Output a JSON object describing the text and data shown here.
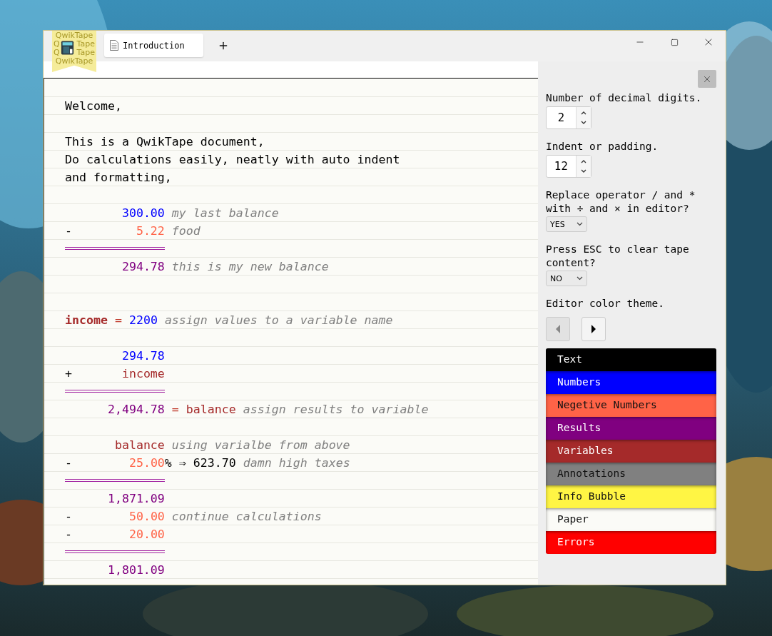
{
  "logo": {
    "pattern": [
      [
        "QwikTape"
      ],
      [
        "Q",
        "Tape"
      ],
      [
        "Q",
        "Tape"
      ],
      [
        "QwikTape"
      ]
    ]
  },
  "tabs": [
    {
      "label": "Introduction",
      "selected": true
    }
  ],
  "tape": [
    {
      "kind": "blank"
    },
    {
      "kind": "text",
      "segments": [
        {
          "text": "Welcome,",
          "kind": "plain"
        }
      ]
    },
    {
      "kind": "blank"
    },
    {
      "kind": "text",
      "segments": [
        {
          "text": "This is a QwikTape document,",
          "kind": "plain"
        }
      ]
    },
    {
      "kind": "text",
      "segments": [
        {
          "text": "Do calculations easily, neatly with auto indent",
          "kind": "plain"
        }
      ]
    },
    {
      "kind": "text",
      "segments": [
        {
          "text": "and formatting,",
          "kind": "plain"
        }
      ]
    },
    {
      "kind": "blank"
    },
    {
      "kind": "calc",
      "value": {
        "text": "300.00",
        "kind": "number"
      },
      "segments": [
        {
          "text": "my last balance",
          "kind": "annotation"
        }
      ]
    },
    {
      "kind": "calc",
      "op": "-",
      "value": {
        "text": "5.22",
        "kind": "negative"
      },
      "segments": [
        {
          "text": "food",
          "kind": "annotation"
        }
      ]
    },
    {
      "kind": "rule"
    },
    {
      "kind": "calc",
      "value": {
        "text": "294.78",
        "kind": "result"
      },
      "segments": [
        {
          "text": "this is my new balance",
          "kind": "annotation"
        }
      ]
    },
    {
      "kind": "blank"
    },
    {
      "kind": "blank"
    },
    {
      "kind": "text",
      "segments": [
        {
          "text": "income",
          "kind": "variable",
          "bold": true
        },
        {
          "text": "=",
          "kind": "operator"
        },
        {
          "text": "2200",
          "kind": "number"
        },
        {
          "text": "assign values to a variable name",
          "kind": "annotation"
        }
      ]
    },
    {
      "kind": "blank"
    },
    {
      "kind": "calc",
      "value": {
        "text": "294.78",
        "kind": "number"
      }
    },
    {
      "kind": "calc",
      "op": "+",
      "value": {
        "text": "income",
        "kind": "variable"
      }
    },
    {
      "kind": "rule"
    },
    {
      "kind": "calc",
      "value": {
        "text": "2,494.78",
        "kind": "result"
      },
      "segments": [
        {
          "text": "=",
          "kind": "operator"
        },
        {
          "text": "balance",
          "kind": "variable"
        },
        {
          "text": "assign results to variable",
          "kind": "annotation"
        }
      ]
    },
    {
      "kind": "blank"
    },
    {
      "kind": "calc",
      "value": {
        "text": "balance",
        "kind": "variable"
      },
      "segments": [
        {
          "text": "using varialbe from above",
          "kind": "annotation"
        }
      ]
    },
    {
      "kind": "calc",
      "op": "-",
      "value": {
        "text": "25.00",
        "kind": "negative"
      },
      "suffix": "%",
      "segments": [
        {
          "text": "⇒",
          "kind": "plain"
        },
        {
          "text": "623.70",
          "kind": "plain"
        },
        {
          "text": "damn high taxes",
          "kind": "annotation"
        }
      ]
    },
    {
      "kind": "rule"
    },
    {
      "kind": "calc",
      "value": {
        "text": "1,871.09",
        "kind": "result"
      }
    },
    {
      "kind": "calc",
      "op": "-",
      "value": {
        "text": "50.00",
        "kind": "negative"
      },
      "segments": [
        {
          "text": "continue calculations",
          "kind": "annotation"
        }
      ]
    },
    {
      "kind": "calc",
      "op": "-",
      "value": {
        "text": "20.00",
        "kind": "negative"
      }
    },
    {
      "kind": "rule"
    },
    {
      "kind": "calc",
      "value": {
        "text": "1,801.09",
        "kind": "result"
      }
    }
  ],
  "settings": [
    {
      "kind": "spinner",
      "label": "Number of decimal digits.",
      "value": "2"
    },
    {
      "kind": "spinner",
      "label": "Indent or padding.",
      "value": "12"
    },
    {
      "kind": "select",
      "label": "Replace operator / and * with ÷ and × in editor?",
      "value": "YES"
    },
    {
      "kind": "select",
      "label": "Press ESC to clear tape content?",
      "value": "NO"
    },
    {
      "kind": "stepper",
      "label": "Editor color theme."
    }
  ],
  "theme_colors": [
    {
      "label": "Text",
      "color": "#000000"
    },
    {
      "label": "Numbers",
      "color": "#0000ff"
    },
    {
      "label": "Negetive Numbers",
      "color": "#ff6347"
    },
    {
      "label": "Results",
      "color": "#800080"
    },
    {
      "label": "Variables",
      "color": "#a52a2a"
    },
    {
      "label": "Annotations",
      "color": "#808080"
    },
    {
      "label": "Info Bubble",
      "color": "#fff544"
    },
    {
      "label": "Paper",
      "color": "#fbfbf7"
    },
    {
      "label": "Errors",
      "color": "#ff0000"
    }
  ]
}
